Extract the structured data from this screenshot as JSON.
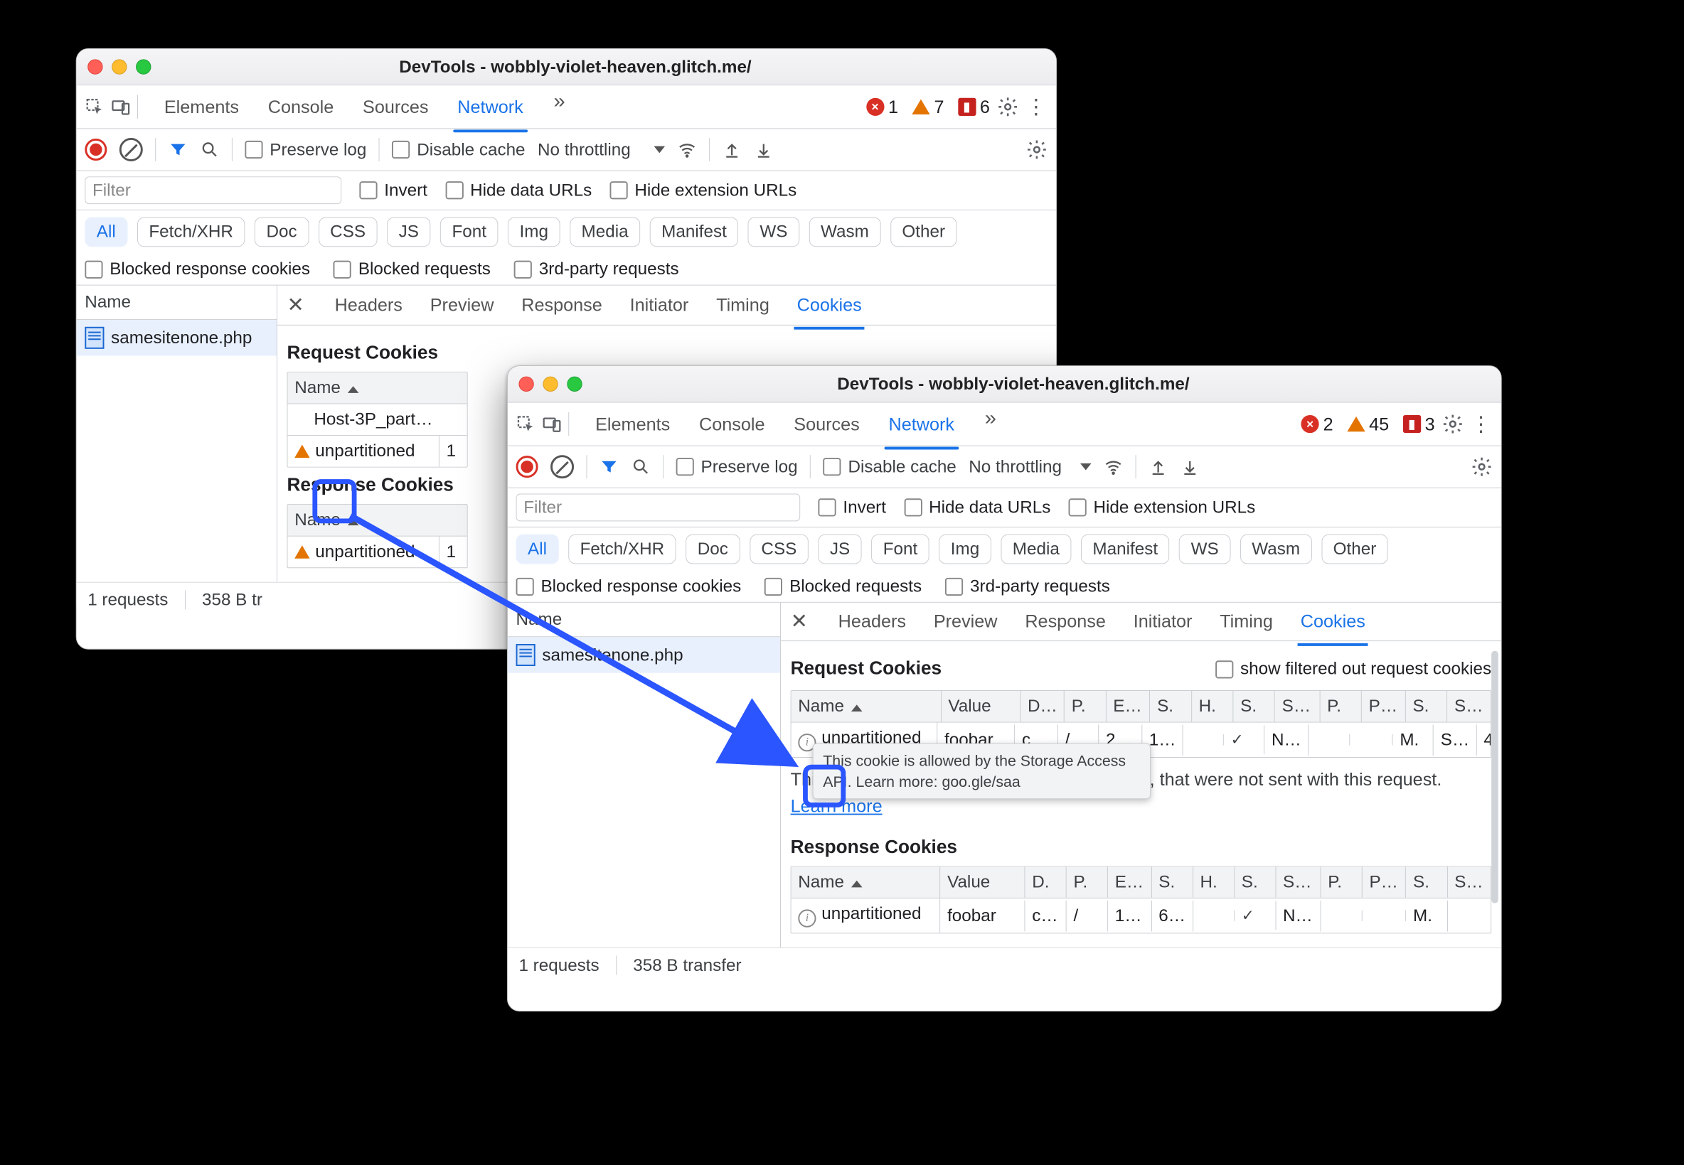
{
  "windowTitle": "DevTools - wobbly-violet-heaven.glitch.me/",
  "mainTabs": {
    "elements": "Elements",
    "console": "Console",
    "sources": "Sources",
    "network": "Network",
    "more": "»"
  },
  "countsBack": {
    "errors": "1",
    "warnings": "7",
    "issues": "6"
  },
  "countsFront": {
    "errors": "2",
    "warnings": "45",
    "issues": "3"
  },
  "toolbar": {
    "preserve": "Preserve log",
    "disableCache": "Disable cache",
    "throttling": "No throttling"
  },
  "filterRow": {
    "placeholder": "Filter",
    "invert": "Invert",
    "hideData": "Hide data URLs",
    "hideExt": "Hide extension URLs"
  },
  "types": {
    "all": "All",
    "fetch": "Fetch/XHR",
    "doc": "Doc",
    "css": "CSS",
    "js": "JS",
    "font": "Font",
    "img": "Img",
    "media": "Media",
    "manifest": "Manifest",
    "ws": "WS",
    "wasm": "Wasm",
    "other": "Other"
  },
  "extraChecks": {
    "blockedCookies": "Blocked response cookies",
    "blockedReq": "Blocked requests",
    "thirdParty": "3rd-party requests"
  },
  "nameHeader": "Name",
  "requestName": "samesitenone.php",
  "detailTabs": {
    "headers": "Headers",
    "preview": "Preview",
    "response": "Response",
    "initiator": "Initiator",
    "timing": "Timing",
    "cookies": "Cookies"
  },
  "sections": {
    "reqCookies": "Request Cookies",
    "respCookies": "Response Cookies",
    "showFiltered": "show filtered out request cookies"
  },
  "back": {
    "reqCols": {
      "name": "Name"
    },
    "reqRows": [
      {
        "name": "Host-3P_part…",
        "icon": "none",
        "v": ""
      },
      {
        "name": "unpartitioned",
        "icon": "warn",
        "v": "1"
      }
    ],
    "respCols": {
      "name": "Name"
    },
    "respRows": [
      {
        "name": "unpartitioned",
        "icon": "warn",
        "v": "1"
      }
    ]
  },
  "frontCols": {
    "name": "Name",
    "value": "Value",
    "d": "D…",
    "p": "P.",
    "e": "E…",
    "s1": "S.",
    "h": "H.",
    "s2": "S.",
    "s3": "S…",
    "p2": "P.",
    "p3": "P…",
    "s4": "S.",
    "s5": "S…"
  },
  "frontCols2": {
    "name": "Name",
    "value": "Value",
    "d": "D.",
    "p": "P.",
    "e": "E…",
    "s1": "S.",
    "h": "H.",
    "s2": "S.",
    "s3": "S…",
    "p2": "P.",
    "p3": "P…",
    "s4": "S.",
    "s5": "S…"
  },
  "frontReqRow": {
    "name": "unpartitioned",
    "value": "foobar",
    "d": "c…",
    "p": "/",
    "e": "2…",
    "s1": "1…",
    "h": "",
    "s2": "✓",
    "s3": "N…",
    "p2": "",
    "p3": "",
    "s4": "M.",
    "s5": "S…",
    "sz": "4…"
  },
  "frontRespRow": {
    "name": "unpartitioned",
    "value": "foobar",
    "d": "c…",
    "p": "/",
    "e": "1…",
    "s1": "6…",
    "h": "",
    "s2": "✓",
    "s3": "N…",
    "p2": "",
    "p3": "",
    "s4": "M.",
    "s5": ""
  },
  "noteText": {
    "prefix": "Thi",
    "middle": "n, that were not sent with this request. ",
    "learn": "Learn more"
  },
  "tooltip": "This cookie is allowed by the Storage Access API. Learn more: goo.gle/saa",
  "status": {
    "reqs": "1 requests",
    "transferBack": "358 B tr",
    "transferFront": "358 B transfer"
  }
}
